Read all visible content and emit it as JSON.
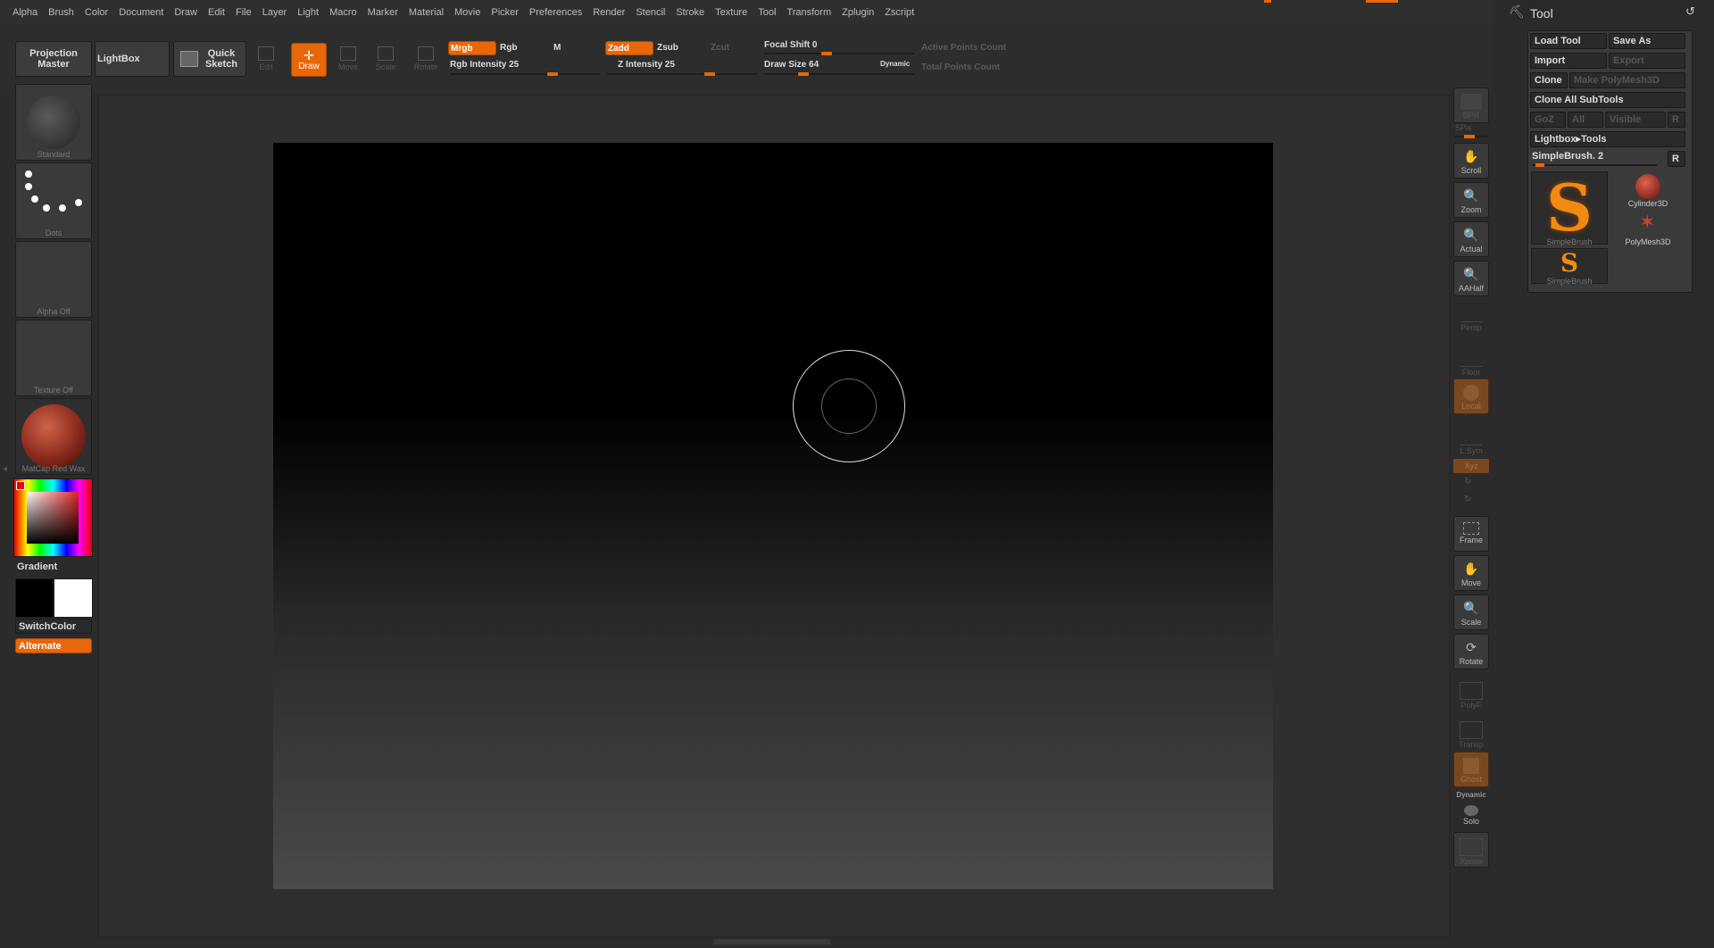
{
  "menu": [
    "Alpha",
    "Brush",
    "Color",
    "Document",
    "Draw",
    "Edit",
    "File",
    "Layer",
    "Light",
    "Macro",
    "Marker",
    "Material",
    "Movie",
    "Picker",
    "Preferences",
    "Render",
    "Stencil",
    "Stroke",
    "Texture",
    "Tool",
    "Transform",
    "Zplugin",
    "Zscript"
  ],
  "shelf": {
    "projection_master": "Projection Master",
    "lightbox": "LightBox",
    "quick_sketch": "Quick Sketch",
    "edit": "Edit",
    "draw": "Draw",
    "move": "Move",
    "scale": "Scale",
    "rotate": "Rotate",
    "mrgb": "Mrgb",
    "rgb": "Rgb",
    "m": "M",
    "rgb_intensity": "Rgb Intensity 25",
    "zadd": "Zadd",
    "zsub": "Zsub",
    "zcut": "Zcut",
    "z_intensity": "Z Intensity 25",
    "focal_shift": "Focal Shift 0",
    "draw_size": "Draw Size 64",
    "dynamic": "Dynamic",
    "active_points": "Active Points Count",
    "total_points": "Total Points Count",
    "rgb_intensity_value": 25,
    "z_intensity_value": 25,
    "focal_shift_value": 0,
    "draw_size_value": 64
  },
  "left": {
    "brush_label": "Standard",
    "stroke_label": "Dots",
    "alpha_label": "Alpha Off",
    "texture_label": "Texture Off",
    "material_label": "MatCap Red Wax",
    "gradient": "Gradient",
    "switch_color": "SwitchColor",
    "alternate": "Alternate"
  },
  "right": {
    "bpr": "BPR",
    "spix": "SPix",
    "scroll": "Scroll",
    "zoom": "Zoom",
    "actual": "Actual",
    "aahalf": "AAHalf",
    "persp": "Persp",
    "floor": "Floor",
    "local": "Local",
    "lsym": "L.Sym",
    "xyz": "Xyz",
    "frame": "Frame",
    "move": "Move",
    "scale": "Scale",
    "rotate": "Rotate",
    "polyf": "PolyF",
    "transp": "Transp",
    "ghost": "Ghost",
    "dynamic": "Dynamic",
    "solo": "Solo",
    "xpose": "Xpose"
  },
  "tool": {
    "title": "Tool",
    "load_tool": "Load Tool",
    "save_as": "Save As",
    "import": "Import",
    "export": "Export",
    "clone": "Clone",
    "make_polymesh": "Make PolyMesh3D",
    "clone_all": "Clone All SubTools",
    "goz": "GoZ",
    "all": "All",
    "visible": "Visible",
    "r": "R",
    "lightbox_tools": "Lightbox▸Tools",
    "current": "SimpleBrush. 2",
    "thumbs": [
      "SimpleBrush",
      "Cylinder3D",
      "PolyMesh3D",
      "SimpleBrush"
    ]
  },
  "colors": {
    "accent": "#e8670a"
  }
}
